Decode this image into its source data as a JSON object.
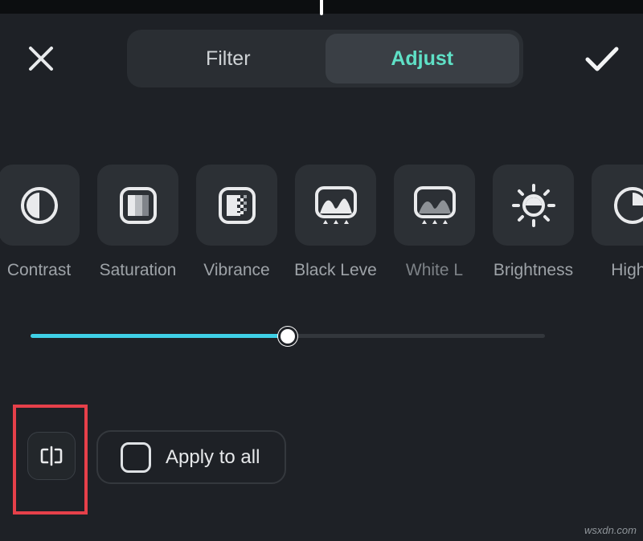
{
  "header": {
    "close_icon": "close-icon",
    "confirm_icon": "checkmark-icon",
    "tabs": [
      {
        "label": "Filter",
        "active": false
      },
      {
        "label": "Adjust",
        "active": true
      }
    ]
  },
  "tools": [
    {
      "label": "Contrast",
      "icon": "contrast-icon"
    },
    {
      "label": "Saturation",
      "icon": "saturation-icon"
    },
    {
      "label": "Vibrance",
      "icon": "vibrance-icon"
    },
    {
      "label": "Black Leve",
      "icon": "black-level-icon"
    },
    {
      "label": "White L",
      "icon": "white-level-icon"
    },
    {
      "label": "Brightness",
      "icon": "brightness-icon"
    },
    {
      "label": "Highli",
      "icon": "highlight-icon"
    }
  ],
  "slider": {
    "value_fraction": 0.5
  },
  "bottom": {
    "compare_icon": "compare-icon",
    "apply_all_label": "Apply to all",
    "apply_all_checked": false
  },
  "colors": {
    "background": "#1e2126",
    "accent": "#5fe0c6",
    "slider_fill": "#3fd0e6",
    "highlight": "#e6404a"
  },
  "watermark": "wsxdn.com"
}
